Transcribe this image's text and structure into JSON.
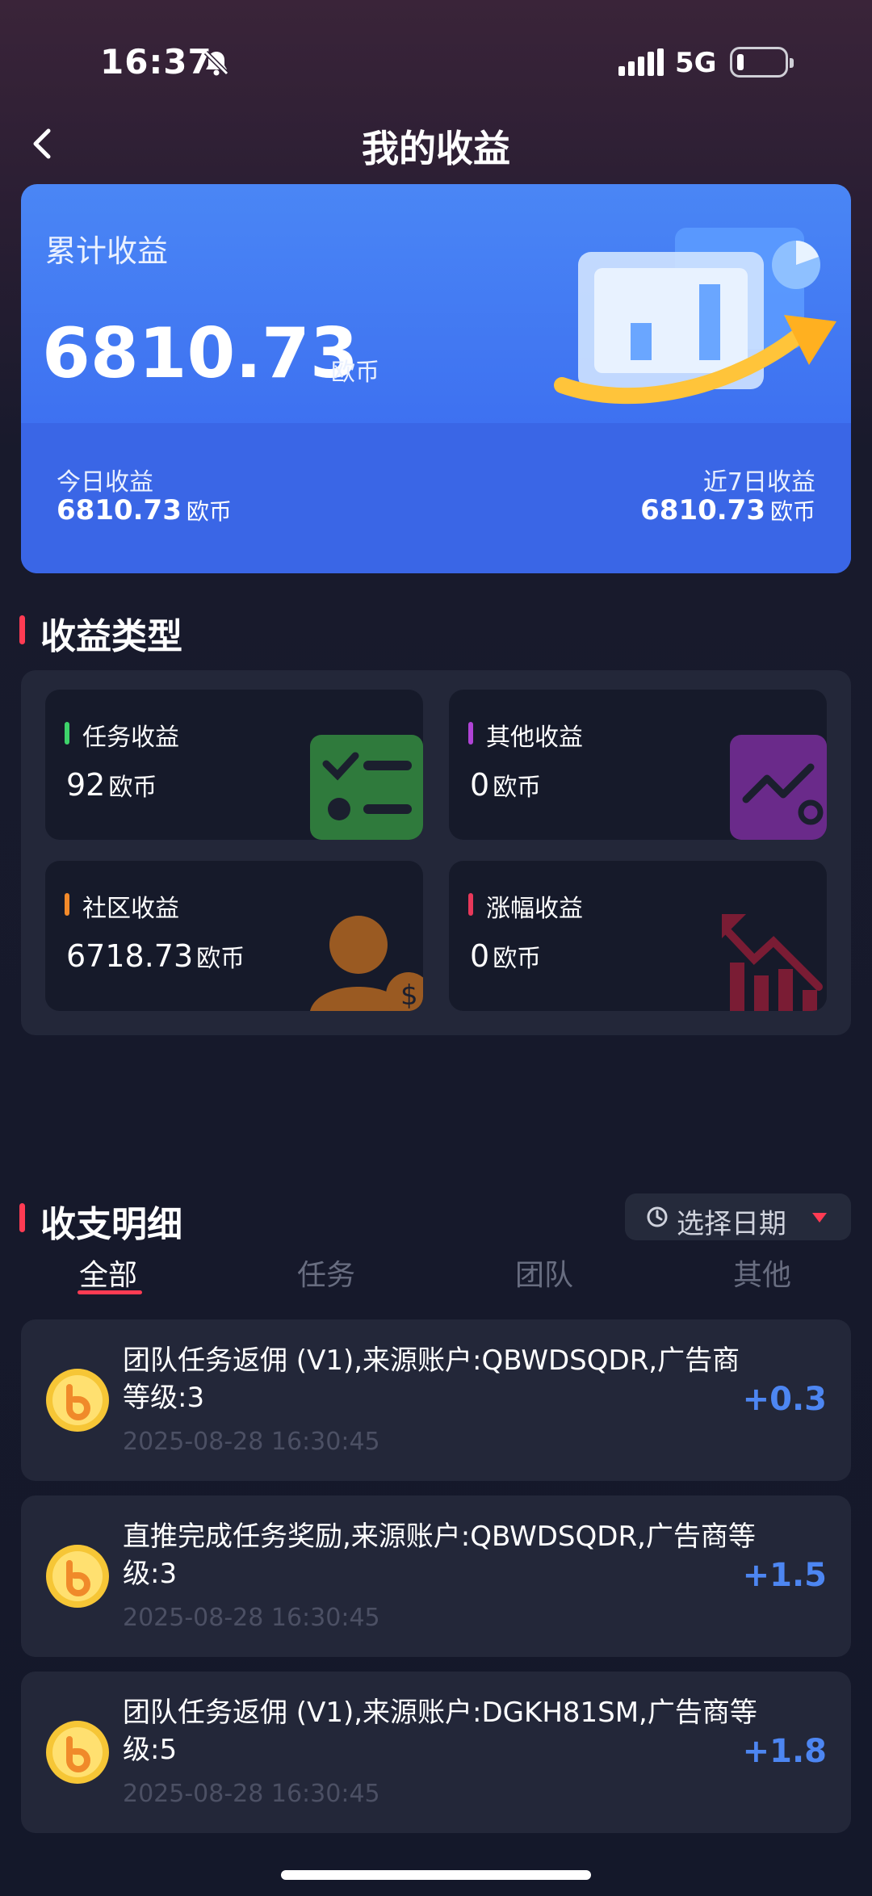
{
  "status_bar": {
    "time": "16:37",
    "network": "5G"
  },
  "header": {
    "title": "我的收益"
  },
  "summary": {
    "total_label": "累计收益",
    "total_value": "6810.73",
    "unit": "欧币",
    "today_label": "今日收益",
    "today_value": "6810.73",
    "week_label": "近7日收益",
    "week_value": "6810.73"
  },
  "income_types": {
    "title": "收益类型",
    "items": [
      {
        "name": "任务收益",
        "value": "92",
        "unit": "欧币",
        "accent": "#3ed36a",
        "icon": "task-list-icon"
      },
      {
        "name": "其他收益",
        "value": "0",
        "unit": "欧币",
        "accent": "#b043d6",
        "icon": "trend-line-icon"
      },
      {
        "name": "社区收益",
        "value": "6718.73",
        "unit": "欧币",
        "accent": "#f38a2a",
        "icon": "community-user-icon"
      },
      {
        "name": "涨幅收益",
        "value": "0",
        "unit": "欧币",
        "accent": "#e8385a",
        "icon": "bar-chart-icon"
      }
    ]
  },
  "details": {
    "title": "收支明细",
    "date_picker": "选择日期",
    "tabs": [
      "全部",
      "任务",
      "团队",
      "其他"
    ],
    "active_tab": "全部",
    "transactions": [
      {
        "title": "团队任务返佣 (V1),来源账户:QBWDSQDR,广告商等级:3",
        "time": "2025-08-28 16:30:45",
        "amount": "+0.3"
      },
      {
        "title": "直推完成任务奖励,来源账户:QBWDSQDR,广告商等级:3",
        "time": "2025-08-28 16:30:45",
        "amount": "+1.5"
      },
      {
        "title": "团队任务返佣 (V1),来源账户:DGKH81SM,广告商等级:5",
        "time": "2025-08-28 16:30:45",
        "amount": "+1.8"
      }
    ]
  }
}
